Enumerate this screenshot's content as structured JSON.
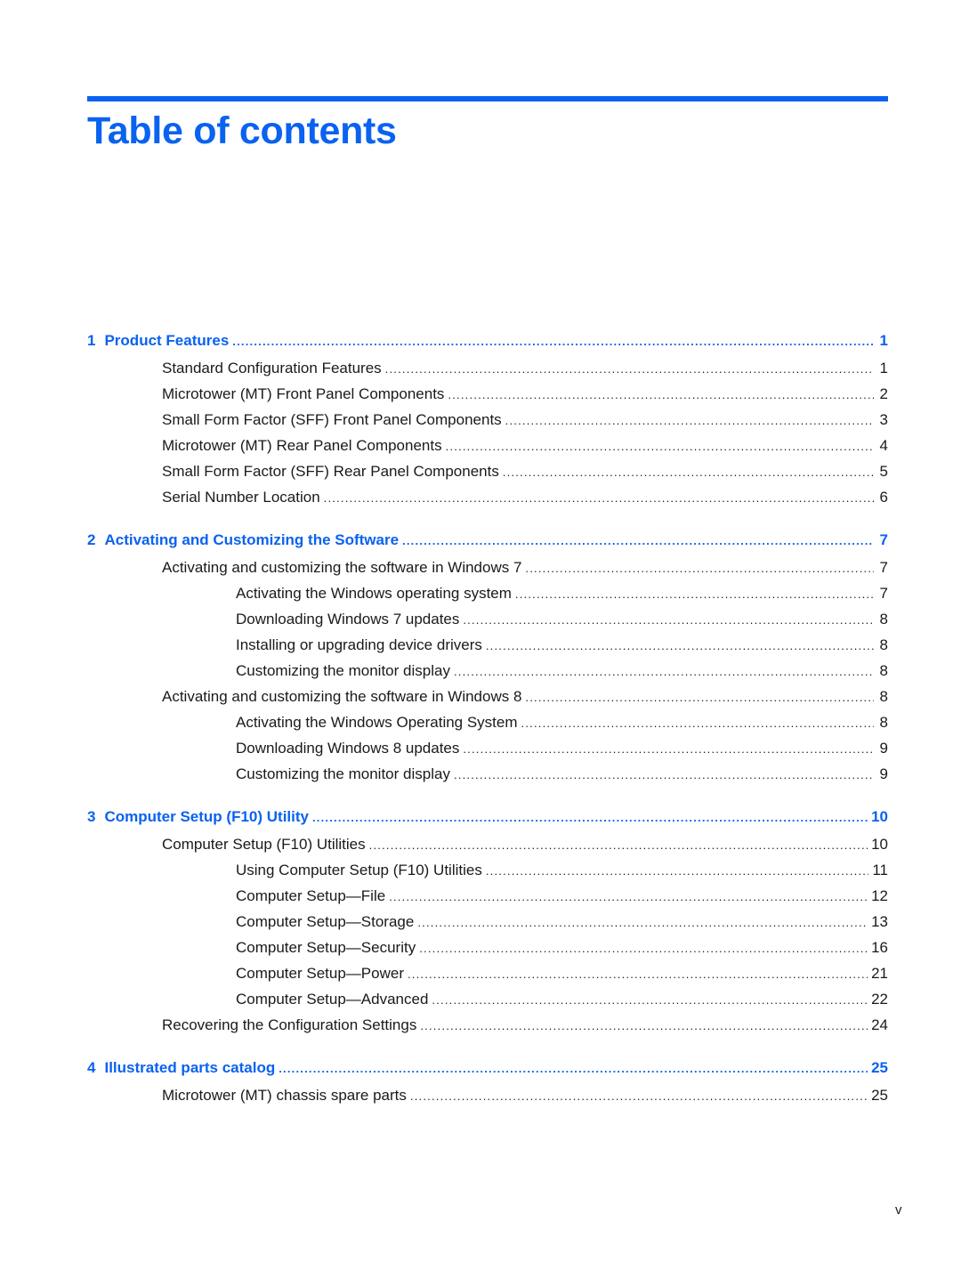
{
  "page": {
    "title": "Table of contents",
    "folio": "v",
    "accent_color": "#0a62f0"
  },
  "chapters": [
    {
      "number": "1",
      "title": "Product Features",
      "page": "1",
      "entries": [
        {
          "level": 1,
          "title": "Standard Configuration Features",
          "page": "1"
        },
        {
          "level": 1,
          "title": "Microtower (MT) Front Panel Components",
          "page": "2"
        },
        {
          "level": 1,
          "title": "Small Form Factor (SFF) Front Panel Components",
          "page": "3"
        },
        {
          "level": 1,
          "title": "Microtower (MT) Rear Panel Components",
          "page": "4"
        },
        {
          "level": 1,
          "title": "Small Form Factor (SFF) Rear Panel Components",
          "page": "5"
        },
        {
          "level": 1,
          "title": "Serial Number Location",
          "page": "6"
        }
      ]
    },
    {
      "number": "2",
      "title": "Activating and Customizing the Software",
      "page": "7",
      "entries": [
        {
          "level": 1,
          "title": "Activating and customizing the software in Windows 7",
          "page": "7"
        },
        {
          "level": 2,
          "title": "Activating the Windows operating system",
          "page": "7"
        },
        {
          "level": 2,
          "title": "Downloading Windows 7 updates",
          "page": "8"
        },
        {
          "level": 2,
          "title": "Installing or upgrading device drivers",
          "page": "8"
        },
        {
          "level": 2,
          "title": "Customizing the monitor display",
          "page": "8"
        },
        {
          "level": 1,
          "title": "Activating and customizing the software in Windows 8",
          "page": "8"
        },
        {
          "level": 2,
          "title": "Activating the Windows Operating System",
          "page": "8"
        },
        {
          "level": 2,
          "title": "Downloading Windows 8 updates",
          "page": "9"
        },
        {
          "level": 2,
          "title": "Customizing the monitor display",
          "page": "9"
        }
      ]
    },
    {
      "number": "3",
      "title": "Computer Setup (F10) Utility",
      "page": "10",
      "entries": [
        {
          "level": 1,
          "title": "Computer Setup (F10) Utilities",
          "page": "10"
        },
        {
          "level": 2,
          "title": "Using Computer Setup (F10) Utilities",
          "page": "11"
        },
        {
          "level": 2,
          "title": "Computer Setup—File",
          "page": "12"
        },
        {
          "level": 2,
          "title": "Computer Setup—Storage",
          "page": "13"
        },
        {
          "level": 2,
          "title": "Computer Setup—Security",
          "page": "16"
        },
        {
          "level": 2,
          "title": "Computer Setup—Power",
          "page": "21"
        },
        {
          "level": 2,
          "title": "Computer Setup—Advanced",
          "page": "22"
        },
        {
          "level": 1,
          "title": "Recovering the Configuration Settings",
          "page": "24"
        }
      ]
    },
    {
      "number": "4",
      "title": "Illustrated parts catalog",
      "page": "25",
      "entries": [
        {
          "level": 1,
          "title": "Microtower (MT) chassis spare parts",
          "page": "25"
        }
      ]
    }
  ]
}
